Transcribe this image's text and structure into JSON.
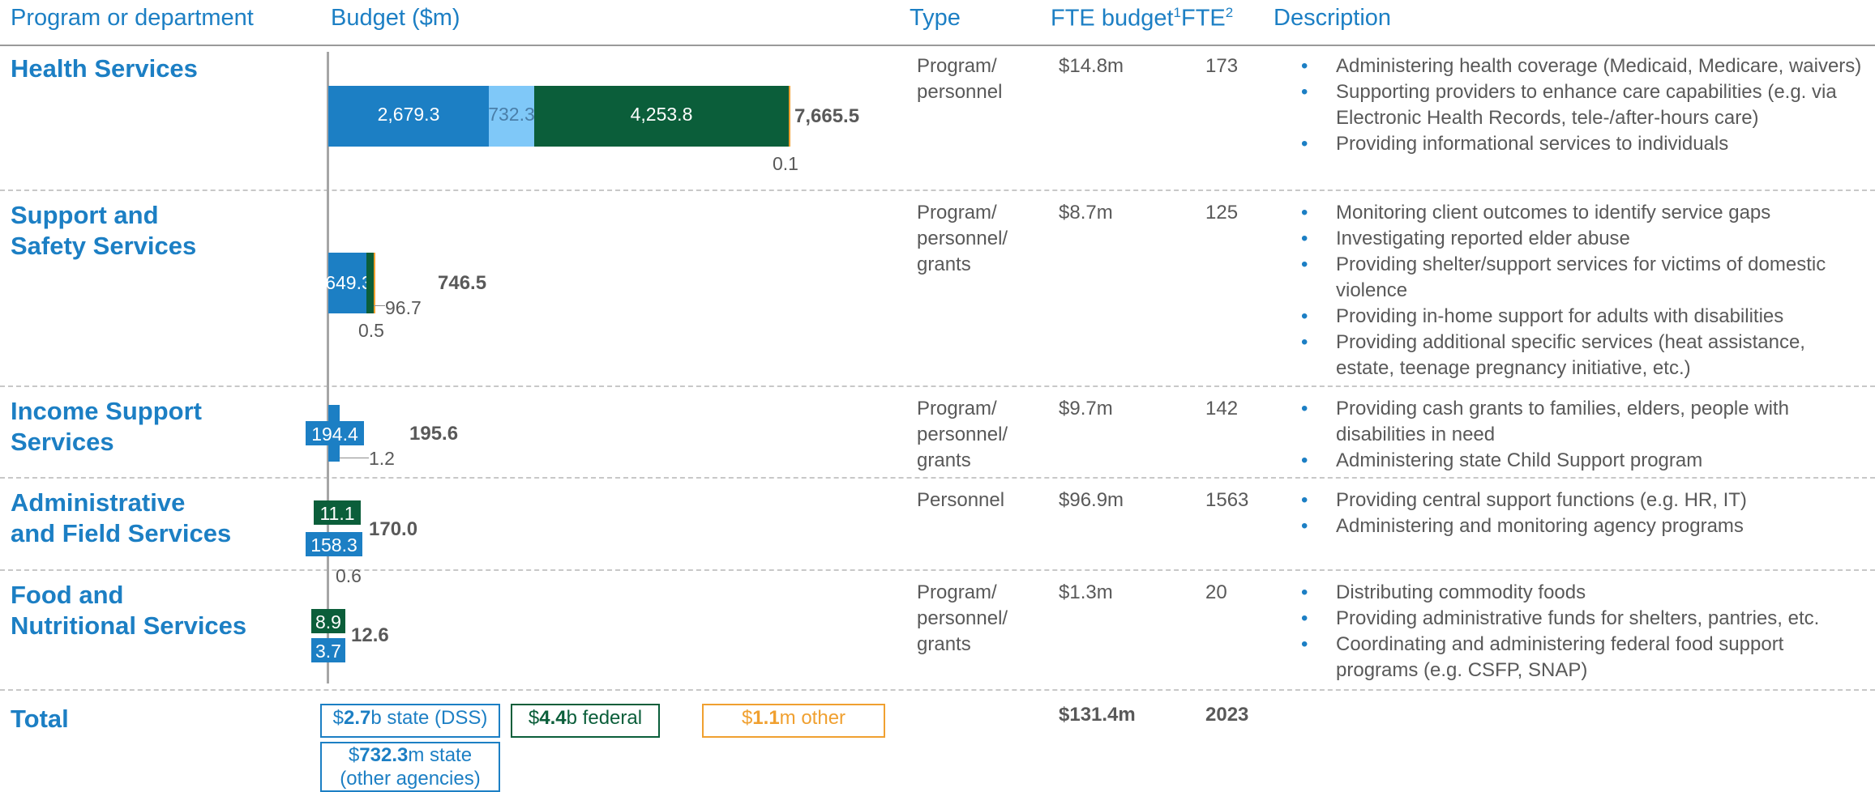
{
  "headers": {
    "program": "Program or department",
    "budget": "Budget ($m)",
    "type": "Type",
    "fte_budget": "FTE budget",
    "fte_budget_note": "1",
    "fte": "FTE",
    "fte_note": "2",
    "description": "Description"
  },
  "colors": {
    "state_dss": "#1c7fc4",
    "state_other": "#7fc8f8",
    "federal": "#0b5e3a",
    "other": "#f0a030",
    "header_text": "#1c7fc4",
    "body_text": "#595959"
  },
  "rows": [
    {
      "program_lines": [
        "Health Services"
      ],
      "type_lines": [
        "Program/",
        "personnel"
      ],
      "fte_budget": "$14.8m",
      "fte": "173",
      "description": [
        "Administering health coverage (Medicaid, Medicare, waivers)",
        "Supporting providers to enhance care capabilities (e.g. via Electronic Health Records, tele-/after-hours care)",
        "Providing informational services to individuals"
      ]
    },
    {
      "program_lines": [
        "Support and",
        "Safety Services"
      ],
      "type_lines": [
        "Program/",
        "personnel/",
        "grants"
      ],
      "fte_budget": "$8.7m",
      "fte": "125",
      "description": [
        "Monitoring client outcomes to identify service gaps",
        "Investigating reported elder abuse",
        "Providing shelter/support services for victims of domestic violence",
        "Providing in-home support for adults with disabilities",
        "Providing additional specific services (heat assistance, estate, teenage pregnancy initiative, etc.)"
      ]
    },
    {
      "program_lines": [
        "Income Support",
        "Services"
      ],
      "type_lines": [
        "Program/",
        "personnel/",
        "grants"
      ],
      "fte_budget": "$9.7m",
      "fte": "142",
      "description": [
        "Providing cash grants to families, elders, people with disabilities in need",
        "Administering state Child Support program"
      ]
    },
    {
      "program_lines": [
        "Administrative",
        "and Field Services"
      ],
      "type_lines": [
        "Personnel"
      ],
      "fte_budget": "$96.9m",
      "fte": "1563",
      "description": [
        "Providing central support functions (e.g. HR, IT)",
        "Administering and monitoring agency programs"
      ]
    },
    {
      "program_lines": [
        "Food and",
        "Nutritional Services"
      ],
      "type_lines": [
        "Program/",
        "personnel/",
        "grants"
      ],
      "fte_budget": "$1.3m",
      "fte": "20",
      "description": [
        "Distributing commodity foods",
        "Providing administrative funds for shelters, pantries, etc.",
        "Coordinating and administering federal food support programs (e.g. CSFP, SNAP)"
      ]
    }
  ],
  "chart_data": {
    "type": "bar",
    "orientation": "horizontal",
    "stacked": true,
    "categories": [
      "Health Services",
      "Support and Safety Services",
      "Income Support Services",
      "Administrative and Field Services",
      "Food and Nutritional Services"
    ],
    "series": [
      {
        "name": "state (DSS)",
        "values": [
          2679.3,
          649.3,
          194.4,
          158.3,
          3.7
        ],
        "labels": [
          "2,679.3",
          "649.3",
          "194.4",
          "158.3",
          "3.7"
        ]
      },
      {
        "name": "state (other agencies)",
        "values": [
          732.3,
          0,
          0,
          0,
          0
        ],
        "labels": [
          "732.3",
          "",
          "",
          "",
          ""
        ]
      },
      {
        "name": "federal",
        "values": [
          4253.8,
          96.7,
          0,
          11.1,
          8.9
        ],
        "labels": [
          "4,253.8",
          "96.7",
          "",
          "11.1",
          "8.9"
        ]
      },
      {
        "name": "other",
        "values": [
          0.1,
          0.5,
          1.2,
          0.6,
          0
        ],
        "labels": [
          "0.1",
          "0.5",
          "1.2",
          "0.6",
          ""
        ]
      }
    ],
    "totals": [
      7665.5,
      746.5,
      195.6,
      170.0,
      12.6
    ],
    "total_labels": [
      "7,665.5",
      "746.5",
      "195.6",
      "170.0",
      "12.6"
    ],
    "grid": false
  },
  "total": {
    "label": "Total",
    "fte_budget": "$131.4m",
    "fte": "2023",
    "legend": {
      "state_dss": {
        "prefix": "$",
        "value": "2.7",
        "suffix": "b state (DSS)"
      },
      "federal": {
        "prefix": "$",
        "value": "4.4",
        "suffix": "b federal"
      },
      "other": {
        "prefix": "$",
        "value": "1.1",
        "suffix": "m other"
      },
      "state_other": {
        "prefix": "$",
        "value": "732.3",
        "suffix": "m state",
        "suffix2": "(other agencies)"
      }
    }
  }
}
